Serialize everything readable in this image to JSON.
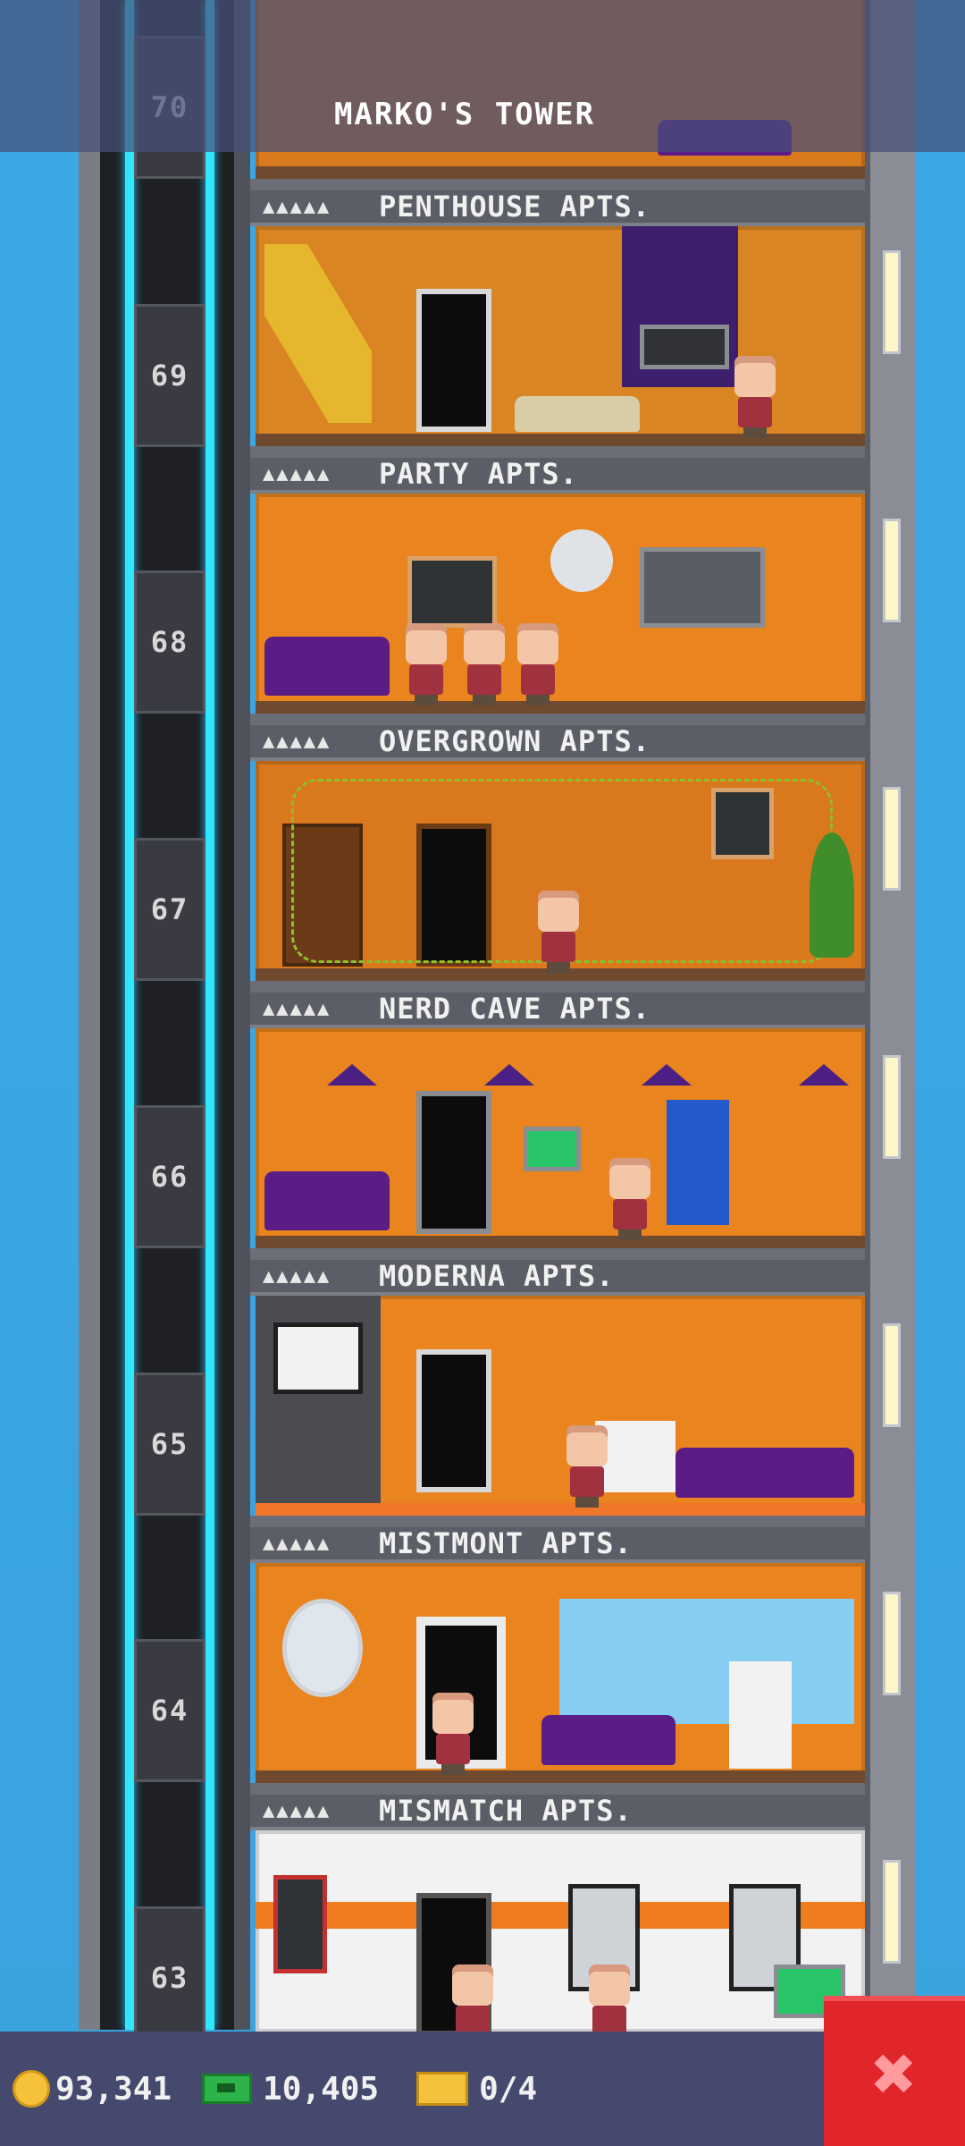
{
  "tower": {
    "title": "MARKO'S TOWER"
  },
  "floors": [
    {
      "number": "70",
      "name": "",
      "stars": ""
    },
    {
      "number": "69",
      "name": "PENTHOUSE APTS.",
      "stars": "▲▲▲▲▲"
    },
    {
      "number": "68",
      "name": "PARTY APTS.",
      "stars": "▲▲▲▲▲"
    },
    {
      "number": "67",
      "name": "OVERGROWN APTS.",
      "stars": "▲▲▲▲▲"
    },
    {
      "number": "66",
      "name": "NERD CAVE APTS.",
      "stars": "▲▲▲▲▲"
    },
    {
      "number": "65",
      "name": "MODERNA APTS.",
      "stars": "▲▲▲▲▲"
    },
    {
      "number": "64",
      "name": "MISTMONT APTS.",
      "stars": "▲▲▲▲▲"
    },
    {
      "number": "63",
      "name": "MISMATCH APTS.",
      "stars": "▲▲▲▲▲"
    }
  ],
  "status": {
    "coins": "93,341",
    "bux": "10,405",
    "tickets": "0/4"
  },
  "close": {
    "icon": "close-icon",
    "glyph": "✖"
  },
  "colors": {
    "sky": "#3aa6e0",
    "room": "#e9841e",
    "elevator_rail": "#2fe7ff",
    "bottom_bar": "#45496e",
    "close": "#e0262b"
  }
}
